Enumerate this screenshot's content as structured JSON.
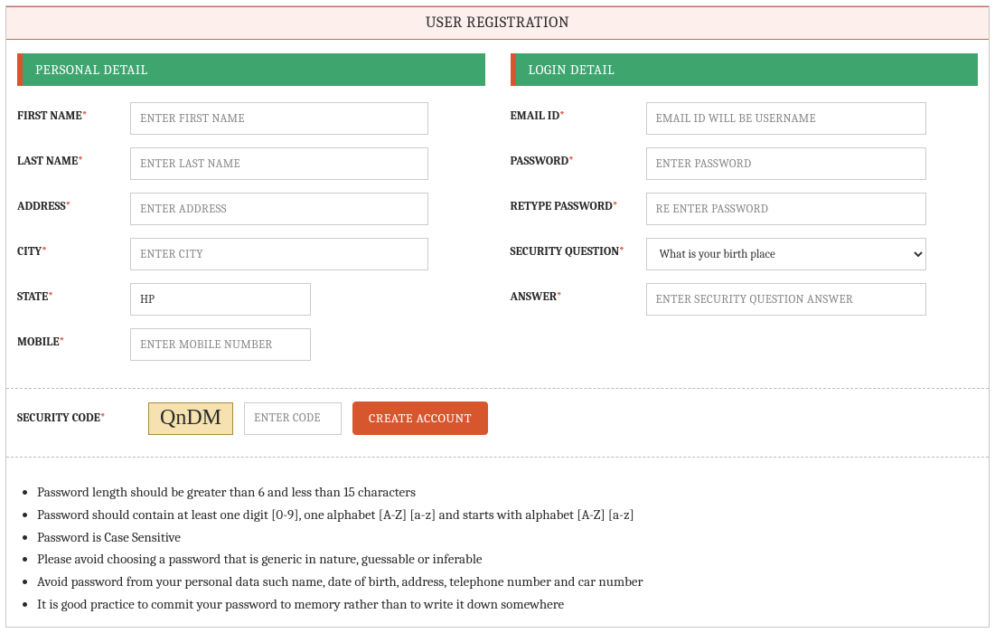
{
  "page_title": "USER REGISTRATION",
  "personal": {
    "header": "PERSONAL DETAIL",
    "first_name": {
      "label": "FIRST NAME",
      "placeholder": "ENTER FIRST NAME"
    },
    "last_name": {
      "label": "LAST NAME",
      "placeholder": "ENTER LAST NAME"
    },
    "address": {
      "label": "ADDRESS",
      "placeholder": "ENTER ADDRESS"
    },
    "city": {
      "label": "CITY",
      "placeholder": "ENTER CITY"
    },
    "state": {
      "label": "STATE",
      "value": "HP"
    },
    "mobile": {
      "label": "MOBILE",
      "placeholder": "ENTER MOBILE NUMBER"
    }
  },
  "login": {
    "header": "LOGIN DETAIL",
    "email": {
      "label": "EMAIL ID",
      "placeholder": "EMAIL ID WILL BE USERNAME"
    },
    "password": {
      "label": "PASSWORD",
      "placeholder": "ENTER PASSWORD"
    },
    "retype": {
      "label": "RETYPE PASSWORD",
      "placeholder": "RE ENTER PASSWORD"
    },
    "question": {
      "label": "SECURITY QUESTION",
      "selected": "What is your birth place"
    },
    "answer": {
      "label": "ANSWER",
      "placeholder": "ENTER SECURITY QUESTION ANSWER"
    }
  },
  "captcha": {
    "label": "SECURITY CODE",
    "code": "QnDM",
    "placeholder": "ENTER CODE"
  },
  "submit_label": "CREATE ACCOUNT",
  "notes": [
    "Password length should be greater than 6 and less than 15 characters",
    "Password should contain at least one digit [0-9], one alphabet [A-Z] [a-z] and starts with alphabet [A-Z] [a-z]",
    "Password is Case Sensitive",
    "Please avoid choosing a password that is generic in nature, guessable or inferable",
    "Avoid password from your personal data such name, date of birth, address, telephone number and car number",
    "It is good practice to commit your password to memory rather than to write it down somewhere"
  ]
}
